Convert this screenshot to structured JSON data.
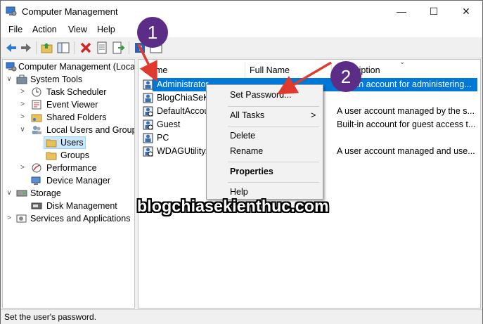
{
  "window": {
    "title": "Computer Management",
    "minimize": "—",
    "maximize": "☐",
    "close": "✕"
  },
  "menubar": [
    "File",
    "Action",
    "View",
    "Help"
  ],
  "toolbar_icons": [
    "back-arrow-icon",
    "forward-arrow-icon",
    "up-folder-icon",
    "show-hide-tree-icon",
    "delete-icon",
    "properties-icon",
    "export-list-icon",
    "help-icon",
    "console-pane-icon"
  ],
  "tree": [
    {
      "label": "Computer Management (Local",
      "level": 0,
      "expander": ""
    },
    {
      "label": "System Tools",
      "level": 1,
      "expander": "∨"
    },
    {
      "label": "Task Scheduler",
      "level": 2,
      "expander": ">"
    },
    {
      "label": "Event Viewer",
      "level": 2,
      "expander": ">"
    },
    {
      "label": "Shared Folders",
      "level": 2,
      "expander": ">"
    },
    {
      "label": "Local Users and Groups",
      "level": 2,
      "expander": "∨"
    },
    {
      "label": "Users",
      "level": 3,
      "expander": ""
    },
    {
      "label": "Groups",
      "level": 3,
      "expander": ""
    },
    {
      "label": "Performance",
      "level": 2,
      "expander": ">"
    },
    {
      "label": "Device Manager",
      "level": 2,
      "expander": ""
    },
    {
      "label": "Storage",
      "level": 1,
      "expander": "∨"
    },
    {
      "label": "Disk Management",
      "level": 2,
      "expander": ""
    },
    {
      "label": "Services and Applications",
      "level": 1,
      "expander": ">"
    }
  ],
  "columns": [
    "Name",
    "Full Name",
    "Description"
  ],
  "users": [
    {
      "name": "Administrator",
      "full_name": "",
      "description": "Built-in account for administering..."
    },
    {
      "name": "BlogChiaSeKie",
      "full_name": "",
      "description": ""
    },
    {
      "name": "DefaultAccou",
      "full_name": "",
      "description": "A user account managed by the s..."
    },
    {
      "name": "Guest",
      "full_name": "",
      "description": "Built-in account for guest access t..."
    },
    {
      "name": "PC",
      "full_name": "",
      "description": ""
    },
    {
      "name": "WDAGUtilityA",
      "full_name": "",
      "description": "A user account managed and use..."
    }
  ],
  "context_menu": {
    "set_password": "Set Password...",
    "all_tasks": "All Tasks",
    "all_tasks_arrow": ">",
    "delete": "Delete",
    "rename": "Rename",
    "properties": "Properties",
    "help": "Help"
  },
  "annotations": {
    "step1": "1",
    "step2": "2",
    "arrow_color": "#e03a2e",
    "badge_color": "#5b2d86"
  },
  "watermark": "blogchiasekienthuc.com",
  "status": "Set the user's password.",
  "colors": {
    "selection": "#0078d7",
    "folder": "#e8c15a"
  }
}
